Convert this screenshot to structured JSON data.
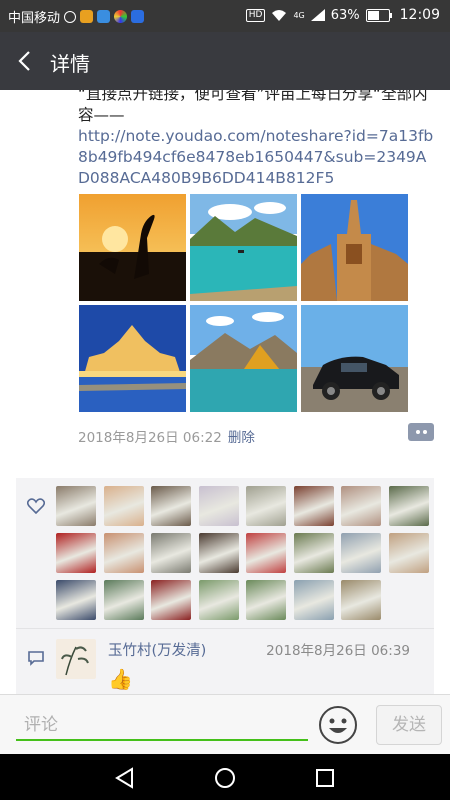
{
  "status_bar": {
    "carrier": "中国移动",
    "network": "4G",
    "battery": "63%",
    "battery_level": 0.63,
    "time": "12:09",
    "hd": "HD"
  },
  "header": {
    "title": "详情"
  },
  "post": {
    "text_partial": "“直接点开链接，便可查看”评亩上每日分享“全部内容——",
    "link": "http://note.youdao.com/noteshare?id=7a13fb8b49fb494cf6e8478eb1650447&sub=2349AD088ACA480B9B6DD414B812F5",
    "photos": [
      "sunset-crane",
      "lake-mountains",
      "cathedral",
      "parliament-night",
      "alpine-lake",
      "black-suv"
    ],
    "timestamp": "2018年8月26日 06:22",
    "delete_label": "删除"
  },
  "likes": {
    "icon": "heart-icon",
    "avatar_colors": [
      "#8a7b6a",
      "#d9b08c",
      "#6a5a4a",
      "#c8c0d0",
      "#a0a090",
      "#7a4030",
      "#b09080",
      "#5a6a4a",
      "#b02020",
      "#c89070",
      "#7a7a70",
      "#4a3a30",
      "#c04040",
      "#6a7a50",
      "#90a0b0",
      "#c0a080",
      "#3a4a6a",
      "#5a7a5a",
      "#8a2020",
      "#7a9a6a",
      "#6a8a5a",
      "#8aa0b0",
      "#9a8a6a"
    ]
  },
  "comment": {
    "author": "玉竹村(万发清)",
    "time": "2018年8月26日 06:39",
    "content": "👍"
  },
  "input_bar": {
    "placeholder": "评论",
    "send_label": "发送"
  },
  "colors": {
    "link": "#576b95",
    "accent_green": "#45c01a",
    "titlebar": "#393a3f"
  }
}
